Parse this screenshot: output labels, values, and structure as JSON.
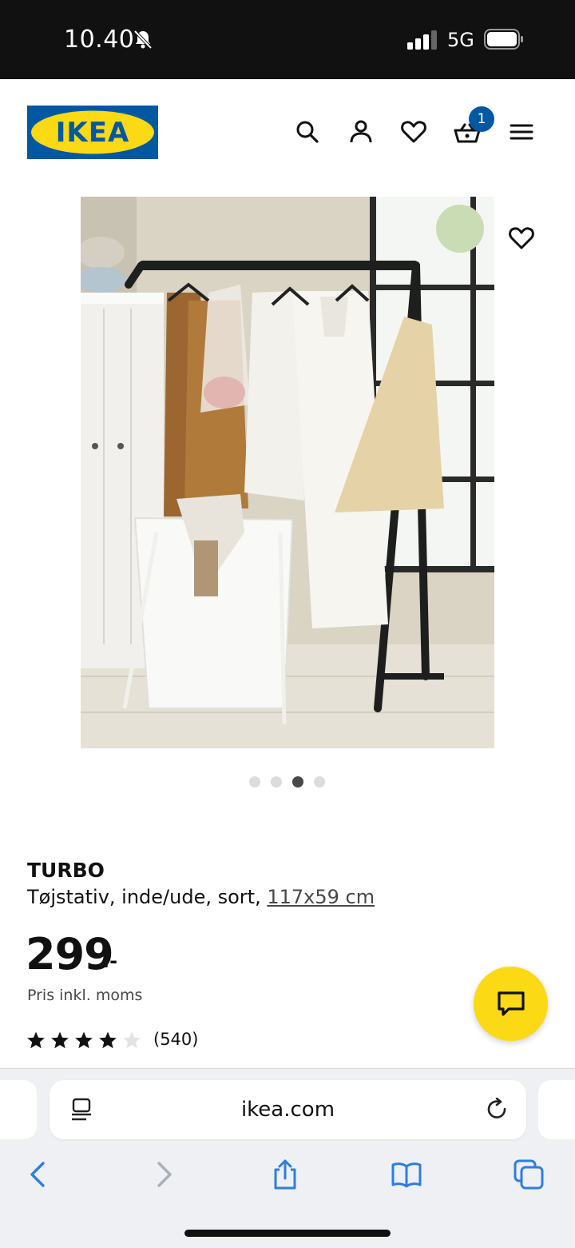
{
  "status_bar": {
    "time": "10.40",
    "network": "5G"
  },
  "header": {
    "logo_text": "IKEA",
    "cart_count": "1",
    "icons": [
      "search-icon",
      "account-icon",
      "heart-icon",
      "basket-icon",
      "menu-icon"
    ]
  },
  "gallery": {
    "image_count": 4,
    "active_index": 2
  },
  "product": {
    "name": "TURBO",
    "description": "Tøjstativ, inde/ude, sort,",
    "dimension_link": "117x59 cm",
    "price": "299",
    "price_suffix": ".-",
    "price_note": "Pris inkl. moms",
    "rating": 4,
    "rating_max": 5,
    "review_count": "(540)"
  },
  "browser": {
    "url": "ikea.com",
    "icons": [
      "back-icon",
      "forward-icon",
      "share-icon",
      "bookmarks-icon",
      "tabs-icon"
    ]
  },
  "colors": {
    "ikea_blue": "#0058a3",
    "ikea_yellow": "#fbd914",
    "ios_blue": "#2f7de1"
  }
}
